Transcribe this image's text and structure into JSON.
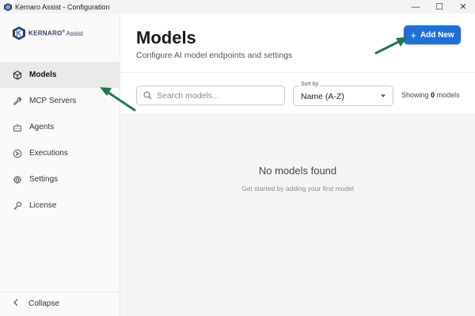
{
  "window": {
    "title": "Kernaro Assist - Configuration",
    "controls": {
      "minimize": "—",
      "maximize": "☐",
      "close": "✕"
    }
  },
  "logo": {
    "brand": "KERNARO",
    "reg": "®",
    "sub": "Assist"
  },
  "sidebar": {
    "items": [
      {
        "label": "Models",
        "icon": "cube-icon",
        "active": true
      },
      {
        "label": "MCP Servers",
        "icon": "wrench-icon",
        "active": false
      },
      {
        "label": "Agents",
        "icon": "robot-icon",
        "active": false
      },
      {
        "label": "Executions",
        "icon": "play-circle-icon",
        "active": false
      },
      {
        "label": "Settings",
        "icon": "gear-icon",
        "active": false
      },
      {
        "label": "License",
        "icon": "key-icon",
        "active": false
      }
    ],
    "collapse_label": "Collapse"
  },
  "header": {
    "title": "Models",
    "subtitle": "Configure AI model endpoints and settings",
    "add_button_label": "Add New"
  },
  "toolbar": {
    "search_placeholder": "Search models...",
    "sort_label": "Sort by",
    "sort_value": "Name (A-Z)",
    "count_prefix": "Showing",
    "count_value": "0",
    "count_suffix": "models"
  },
  "empty_state": {
    "title": "No models found",
    "subtitle": "Get started by adding your first model"
  },
  "colors": {
    "accent": "#1f6fd6",
    "annotation_arrow": "#1e7a4e",
    "sidebar_active": "#eaeaea"
  }
}
